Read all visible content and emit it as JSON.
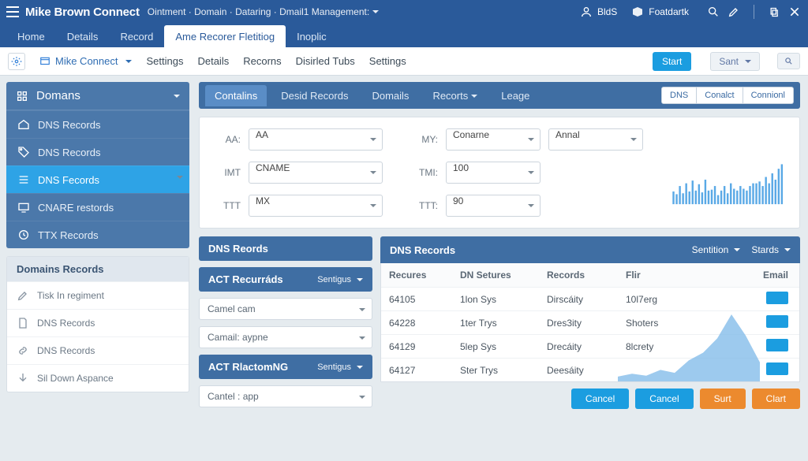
{
  "top": {
    "brand": "Mike Brown Connect",
    "crumbs": "Ointment · Domain · Dataring · Dmail1 Management:",
    "user": "BldS",
    "feedback": "Foatdartk"
  },
  "ptabs": {
    "items": [
      "Home",
      "Details",
      "Record",
      "Ame Recorer Fletitiog",
      "Inoplic"
    ],
    "active": 3
  },
  "subbar": {
    "connect": "Mike Connect",
    "links": [
      "Settings",
      "Details",
      "Recorns",
      "Disirled Tubs",
      "Settings"
    ],
    "start": "Start",
    "sort": "Sant"
  },
  "sidebar": {
    "main": {
      "title": "Domans",
      "items": [
        {
          "icon": "home",
          "label": "DNS Records"
        },
        {
          "icon": "tag",
          "label": "DNS Records"
        },
        {
          "icon": "list",
          "label": "DNS Fecords",
          "selected": true
        },
        {
          "icon": "screen",
          "label": "CNARE restords"
        },
        {
          "icon": "clock",
          "label": "TTX Records"
        }
      ]
    },
    "secondary": {
      "title": "Domains Records",
      "items": [
        {
          "icon": "pencil",
          "label": "Tisk In regiment"
        },
        {
          "icon": "doc",
          "label": "DNS Records"
        },
        {
          "icon": "link",
          "label": "DNS Records"
        },
        {
          "icon": "down",
          "label": "Sil Down Aspance"
        }
      ]
    }
  },
  "tabstrip": {
    "items": [
      "Contalins",
      "Desid Records",
      "Domails",
      "Recorts",
      "Leage"
    ],
    "active": 0,
    "pills": [
      "DNS",
      "Conalct",
      "Connionl"
    ]
  },
  "form": {
    "left": [
      {
        "label": "AA:",
        "value": "AA"
      },
      {
        "label": "IMT",
        "value": "CNAME"
      },
      {
        "label": "TTT",
        "value": "MX"
      }
    ],
    "right": [
      {
        "label": "MY:",
        "value": "Conarne",
        "extra": "Annal"
      },
      {
        "label": "TMI:",
        "value": "100"
      },
      {
        "label": "TTT:",
        "value": "90"
      }
    ]
  },
  "leftstack": {
    "head1": "DNS Reords",
    "p1": {
      "title": "ACT Recurráds",
      "tag": "Sentigus",
      "opts": [
        "Camel cam",
        "Camail: aypne"
      ]
    },
    "p2": {
      "title": "ACT RlactomNG",
      "tag": "Sentigus",
      "opts": [
        "Cantel : app"
      ]
    }
  },
  "table": {
    "title": "DNS Records",
    "menus": [
      "Sentition",
      "Stards"
    ],
    "cols": [
      "Recures",
      "DN Setures",
      "Records",
      "Flir",
      "Email"
    ],
    "rows": [
      {
        "a": "64105",
        "b": "1lon Sys",
        "c": "Dirscáity",
        "d": "10l7erg"
      },
      {
        "a": "64228",
        "b": "1ter Trys",
        "c": "Dres3ity",
        "d": "Shoters"
      },
      {
        "a": "64129",
        "b": "5lep Sys",
        "c": "Drecáity",
        "d": "8lcrety"
      },
      {
        "a": "64127",
        "b": "Ster Trys",
        "c": "Deesáity",
        "d": ""
      }
    ]
  },
  "buttons": [
    "Cancel",
    "Cancel",
    "Surt",
    "Clart"
  ],
  "chart_data": {
    "type": "bar",
    "title": "",
    "xlabel": "",
    "ylabel": "",
    "ylim": [
      0,
      100
    ],
    "categories": [
      "1",
      "2",
      "3",
      "4",
      "5",
      "6",
      "7",
      "8",
      "9",
      "10",
      "11",
      "12",
      "13",
      "14",
      "15",
      "16",
      "17",
      "18",
      "19",
      "20",
      "21",
      "22",
      "23",
      "24",
      "25",
      "26",
      "27",
      "28",
      "29",
      "30",
      "31",
      "32",
      "33",
      "34",
      "35"
    ],
    "values": [
      28,
      22,
      40,
      24,
      46,
      28,
      52,
      30,
      44,
      26,
      54,
      30,
      32,
      40,
      20,
      30,
      40,
      24,
      46,
      34,
      30,
      40,
      34,
      30,
      40,
      46,
      46,
      50,
      40,
      60,
      46,
      68,
      54,
      78,
      88
    ]
  },
  "area_chart": {
    "type": "area",
    "x": [
      0,
      1,
      2,
      3,
      4,
      5,
      6,
      7,
      8,
      9,
      10
    ],
    "y": [
      5,
      8,
      6,
      12,
      9,
      22,
      30,
      45,
      70,
      48,
      20
    ]
  }
}
